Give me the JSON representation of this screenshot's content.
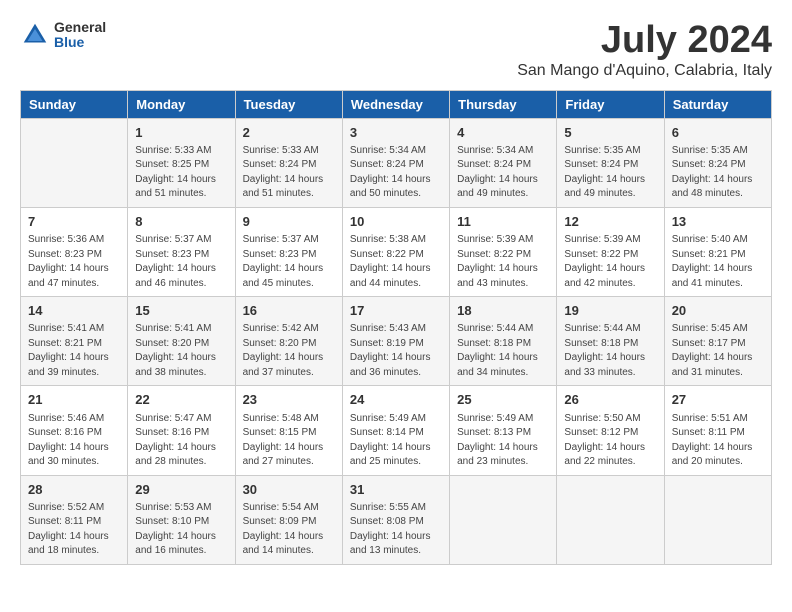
{
  "header": {
    "logo_general": "General",
    "logo_blue": "Blue",
    "title": "July 2024",
    "subtitle": "San Mango d'Aquino, Calabria, Italy"
  },
  "days_of_week": [
    "Sunday",
    "Monday",
    "Tuesday",
    "Wednesday",
    "Thursday",
    "Friday",
    "Saturday"
  ],
  "weeks": [
    [
      {
        "day": "",
        "info": ""
      },
      {
        "day": "1",
        "info": "Sunrise: 5:33 AM\nSunset: 8:25 PM\nDaylight: 14 hours\nand 51 minutes."
      },
      {
        "day": "2",
        "info": "Sunrise: 5:33 AM\nSunset: 8:24 PM\nDaylight: 14 hours\nand 51 minutes."
      },
      {
        "day": "3",
        "info": "Sunrise: 5:34 AM\nSunset: 8:24 PM\nDaylight: 14 hours\nand 50 minutes."
      },
      {
        "day": "4",
        "info": "Sunrise: 5:34 AM\nSunset: 8:24 PM\nDaylight: 14 hours\nand 49 minutes."
      },
      {
        "day": "5",
        "info": "Sunrise: 5:35 AM\nSunset: 8:24 PM\nDaylight: 14 hours\nand 49 minutes."
      },
      {
        "day": "6",
        "info": "Sunrise: 5:35 AM\nSunset: 8:24 PM\nDaylight: 14 hours\nand 48 minutes."
      }
    ],
    [
      {
        "day": "7",
        "info": "Sunrise: 5:36 AM\nSunset: 8:23 PM\nDaylight: 14 hours\nand 47 minutes."
      },
      {
        "day": "8",
        "info": "Sunrise: 5:37 AM\nSunset: 8:23 PM\nDaylight: 14 hours\nand 46 minutes."
      },
      {
        "day": "9",
        "info": "Sunrise: 5:37 AM\nSunset: 8:23 PM\nDaylight: 14 hours\nand 45 minutes."
      },
      {
        "day": "10",
        "info": "Sunrise: 5:38 AM\nSunset: 8:22 PM\nDaylight: 14 hours\nand 44 minutes."
      },
      {
        "day": "11",
        "info": "Sunrise: 5:39 AM\nSunset: 8:22 PM\nDaylight: 14 hours\nand 43 minutes."
      },
      {
        "day": "12",
        "info": "Sunrise: 5:39 AM\nSunset: 8:22 PM\nDaylight: 14 hours\nand 42 minutes."
      },
      {
        "day": "13",
        "info": "Sunrise: 5:40 AM\nSunset: 8:21 PM\nDaylight: 14 hours\nand 41 minutes."
      }
    ],
    [
      {
        "day": "14",
        "info": "Sunrise: 5:41 AM\nSunset: 8:21 PM\nDaylight: 14 hours\nand 39 minutes."
      },
      {
        "day": "15",
        "info": "Sunrise: 5:41 AM\nSunset: 8:20 PM\nDaylight: 14 hours\nand 38 minutes."
      },
      {
        "day": "16",
        "info": "Sunrise: 5:42 AM\nSunset: 8:20 PM\nDaylight: 14 hours\nand 37 minutes."
      },
      {
        "day": "17",
        "info": "Sunrise: 5:43 AM\nSunset: 8:19 PM\nDaylight: 14 hours\nand 36 minutes."
      },
      {
        "day": "18",
        "info": "Sunrise: 5:44 AM\nSunset: 8:18 PM\nDaylight: 14 hours\nand 34 minutes."
      },
      {
        "day": "19",
        "info": "Sunrise: 5:44 AM\nSunset: 8:18 PM\nDaylight: 14 hours\nand 33 minutes."
      },
      {
        "day": "20",
        "info": "Sunrise: 5:45 AM\nSunset: 8:17 PM\nDaylight: 14 hours\nand 31 minutes."
      }
    ],
    [
      {
        "day": "21",
        "info": "Sunrise: 5:46 AM\nSunset: 8:16 PM\nDaylight: 14 hours\nand 30 minutes."
      },
      {
        "day": "22",
        "info": "Sunrise: 5:47 AM\nSunset: 8:16 PM\nDaylight: 14 hours\nand 28 minutes."
      },
      {
        "day": "23",
        "info": "Sunrise: 5:48 AM\nSunset: 8:15 PM\nDaylight: 14 hours\nand 27 minutes."
      },
      {
        "day": "24",
        "info": "Sunrise: 5:49 AM\nSunset: 8:14 PM\nDaylight: 14 hours\nand 25 minutes."
      },
      {
        "day": "25",
        "info": "Sunrise: 5:49 AM\nSunset: 8:13 PM\nDaylight: 14 hours\nand 23 minutes."
      },
      {
        "day": "26",
        "info": "Sunrise: 5:50 AM\nSunset: 8:12 PM\nDaylight: 14 hours\nand 22 minutes."
      },
      {
        "day": "27",
        "info": "Sunrise: 5:51 AM\nSunset: 8:11 PM\nDaylight: 14 hours\nand 20 minutes."
      }
    ],
    [
      {
        "day": "28",
        "info": "Sunrise: 5:52 AM\nSunset: 8:11 PM\nDaylight: 14 hours\nand 18 minutes."
      },
      {
        "day": "29",
        "info": "Sunrise: 5:53 AM\nSunset: 8:10 PM\nDaylight: 14 hours\nand 16 minutes."
      },
      {
        "day": "30",
        "info": "Sunrise: 5:54 AM\nSunset: 8:09 PM\nDaylight: 14 hours\nand 14 minutes."
      },
      {
        "day": "31",
        "info": "Sunrise: 5:55 AM\nSunset: 8:08 PM\nDaylight: 14 hours\nand 13 minutes."
      },
      {
        "day": "",
        "info": ""
      },
      {
        "day": "",
        "info": ""
      },
      {
        "day": "",
        "info": ""
      }
    ]
  ]
}
